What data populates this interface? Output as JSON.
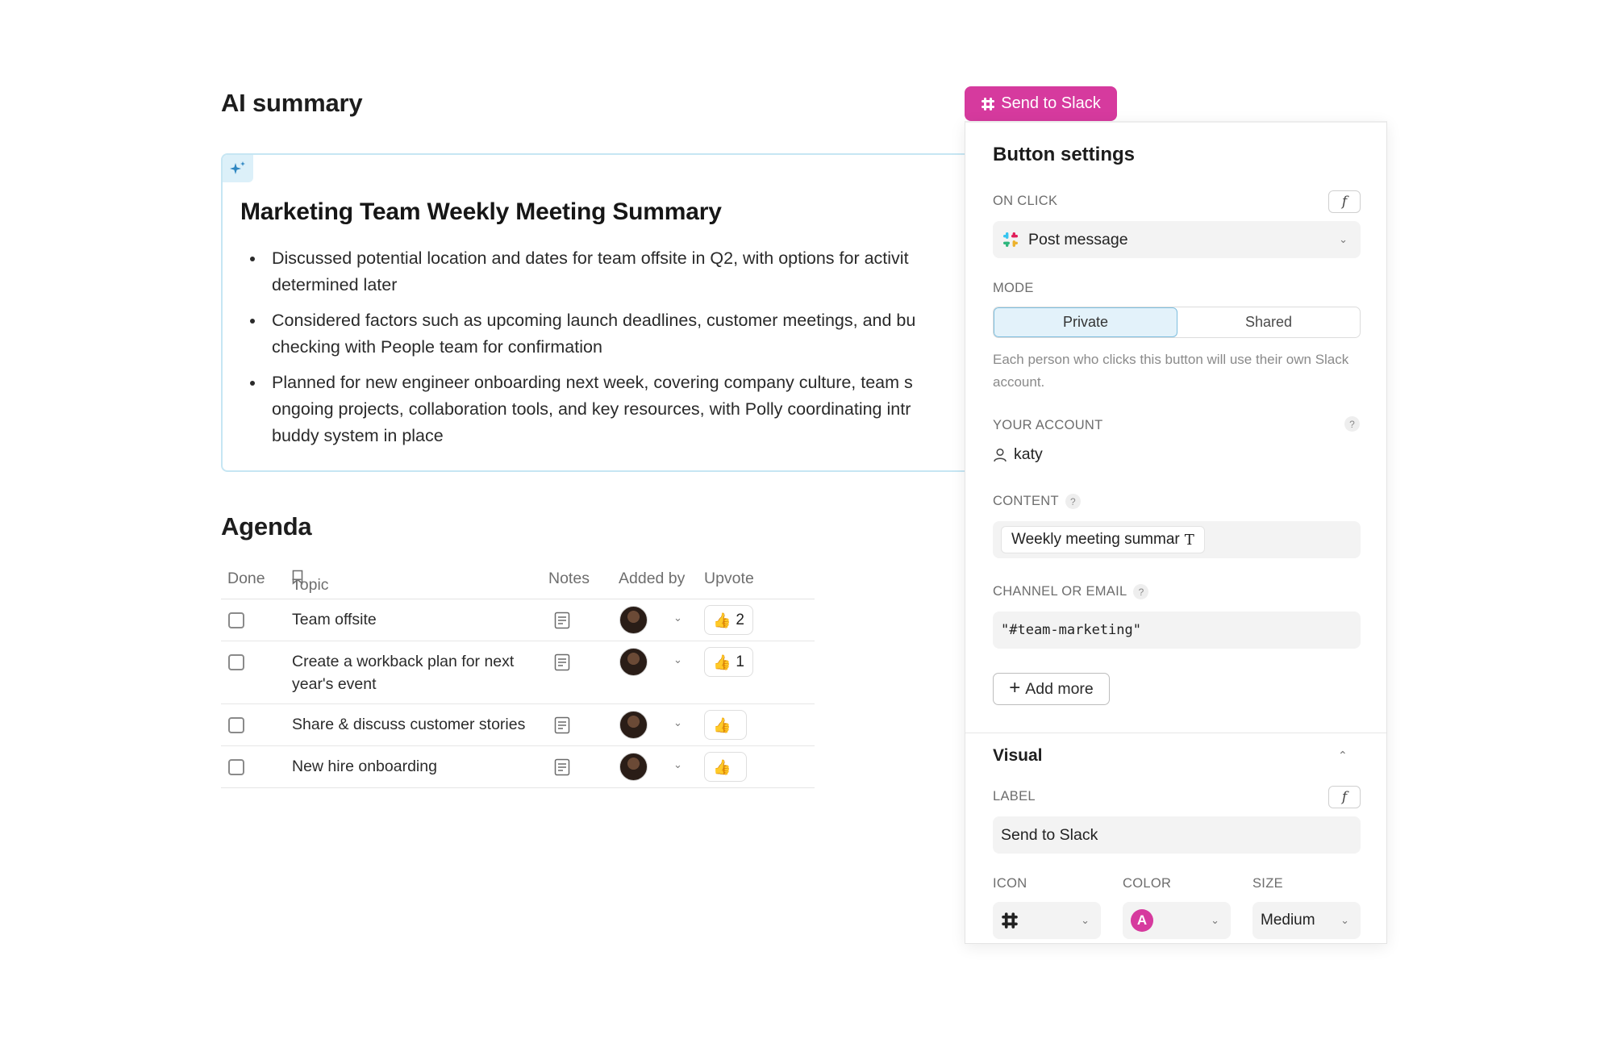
{
  "doc": {
    "ai_heading": "AI summary",
    "summary_title": "Marketing Team Weekly Meeting Summary",
    "bullets": [
      {
        "line1": "Discussed potential location and dates for team offsite in Q2, with options for activit",
        "line2": "determined later"
      },
      {
        "line1": "Considered factors such as upcoming launch deadlines, customer meetings, and bu",
        "line2": "checking with People team for confirmation"
      },
      {
        "line1": "Planned for new engineer onboarding next week, covering company culture, team s",
        "line2": "ongoing projects, collaboration tools, and key resources, with Polly coordinating intr",
        "line3": "buddy system in place"
      }
    ],
    "agenda_heading": "Agenda",
    "columns": {
      "done": "Done",
      "topic": "Topic",
      "notes": "Notes",
      "added_by": "Added by",
      "upvote": "Upvote"
    },
    "rows": [
      {
        "topic": "Team offsite",
        "upvotes": "2"
      },
      {
        "topic": "Create a workback plan for next year's event",
        "upvotes": "1"
      },
      {
        "topic": "Share & discuss customer stories",
        "upvotes": ""
      },
      {
        "topic": "New hire onboarding",
        "upvotes": ""
      }
    ]
  },
  "send_button": {
    "label": "Send to Slack",
    "color": "#d63a9e"
  },
  "panel": {
    "title": "Button settings",
    "on_click_label": "ON CLICK",
    "on_click_value": "Post message",
    "mode_label": "MODE",
    "mode_options": [
      "Private",
      "Shared"
    ],
    "mode_selected": "Private",
    "mode_helper": "Each person who clicks this button will use their own Slack account.",
    "account_label": "YOUR ACCOUNT",
    "account_value": "katy",
    "content_label": "CONTENT",
    "content_chip": "Weekly meeting summar",
    "channel_label": "CHANNEL OR EMAIL",
    "channel_value": "\"#team-marketing\"",
    "add_more": "Add more",
    "visual_title": "Visual",
    "label_label": "LABEL",
    "label_value": "Send to Slack",
    "icon_label": "ICON",
    "color_label": "COLOR",
    "color_value": "A",
    "size_label": "SIZE",
    "size_value": "Medium"
  }
}
